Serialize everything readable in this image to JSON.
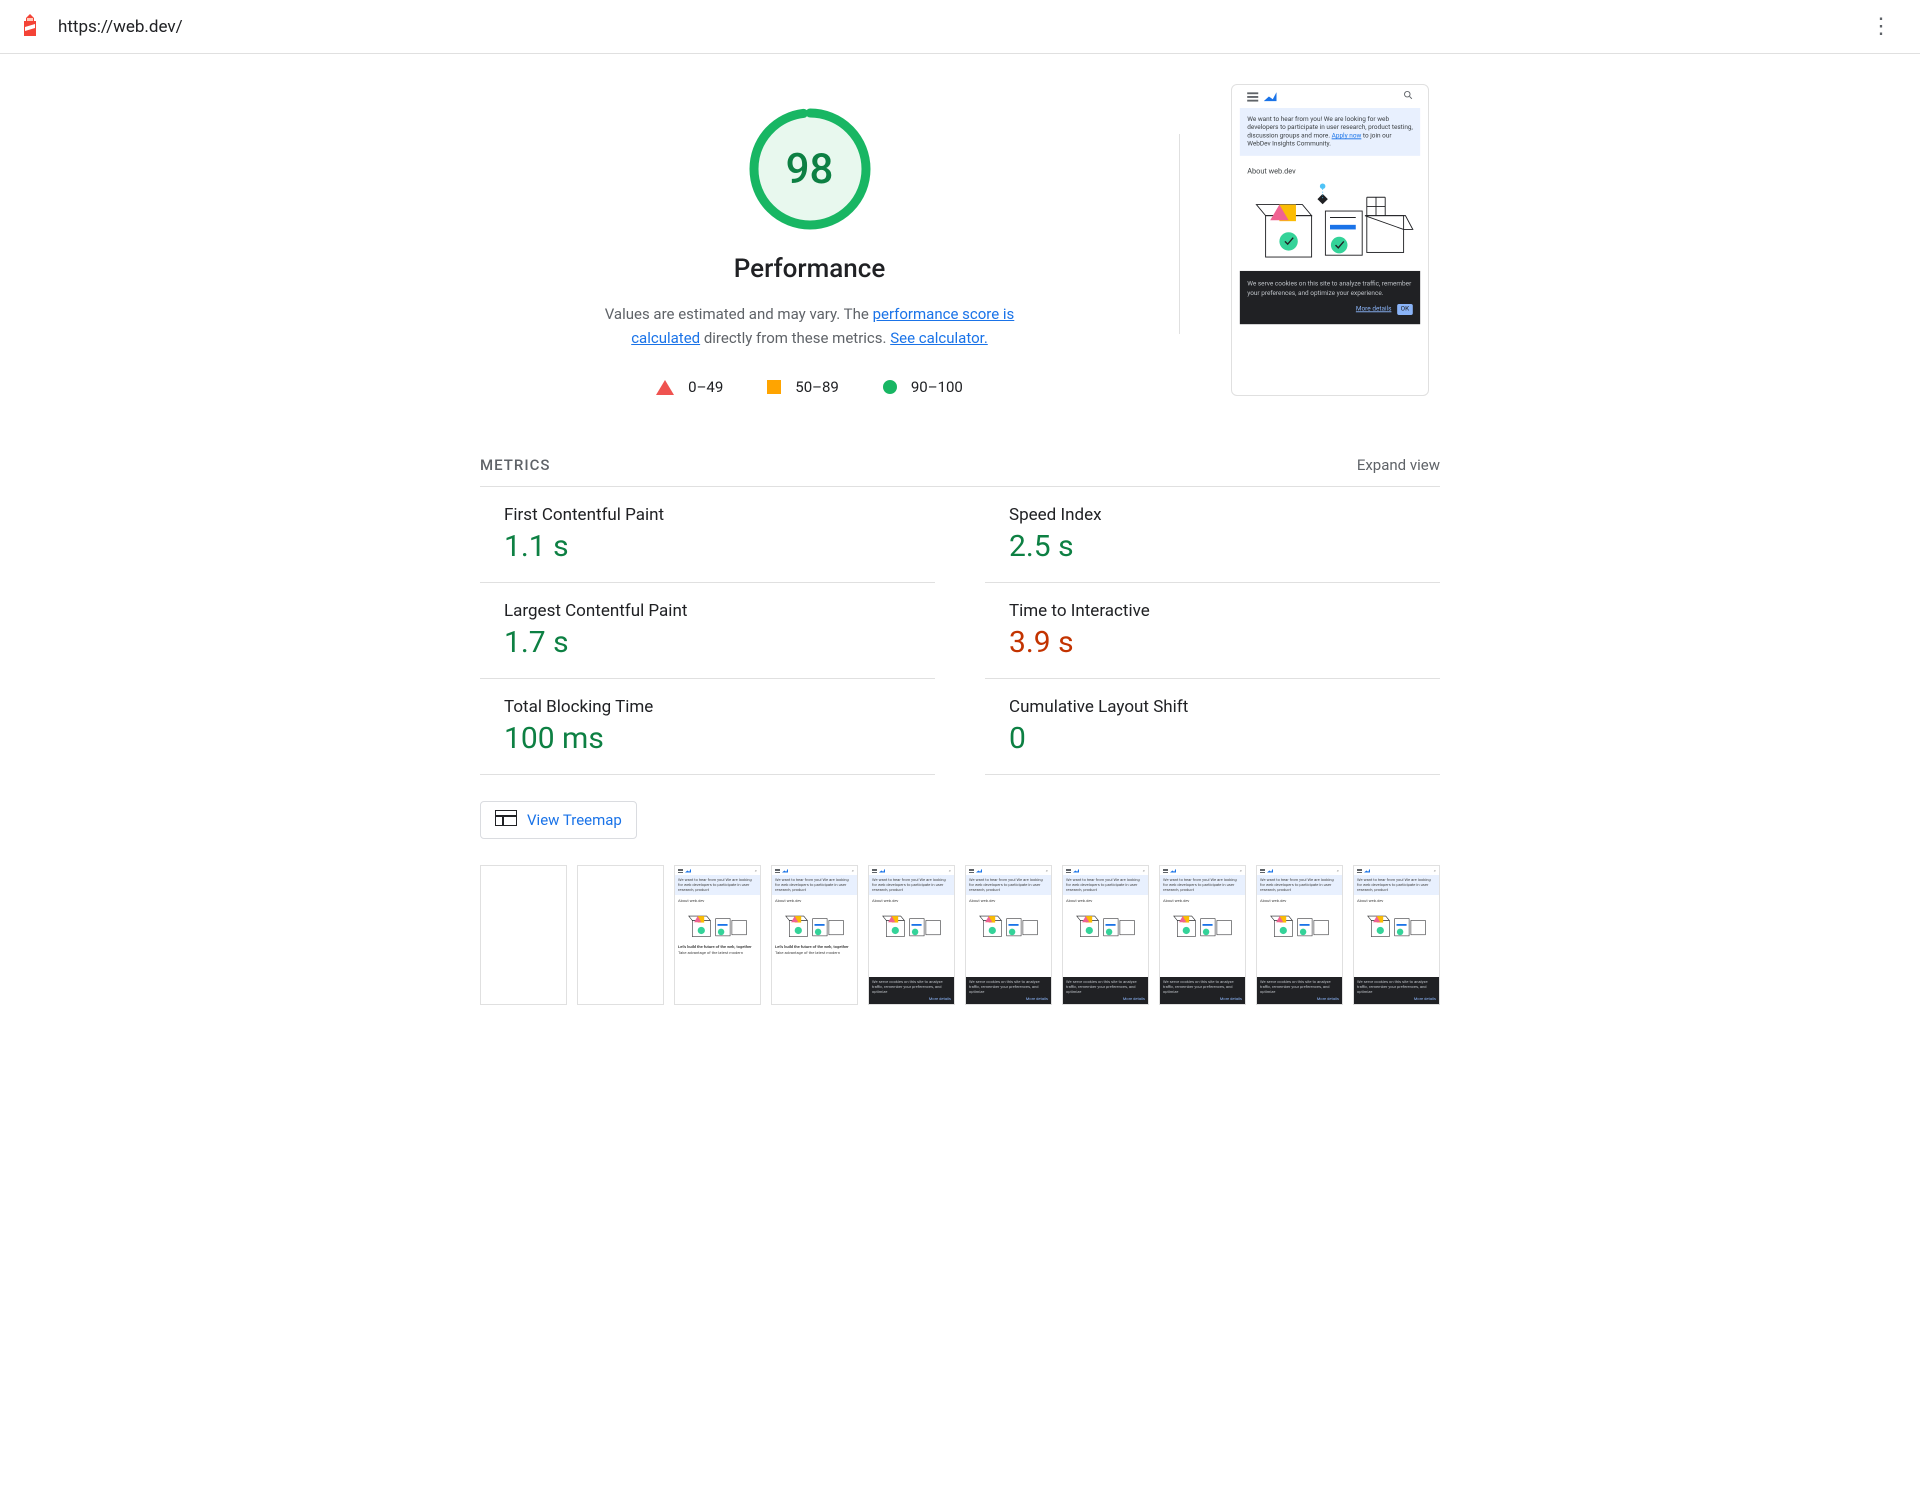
{
  "header": {
    "url": "https://web.dev/"
  },
  "performance": {
    "score": "98",
    "category_label": "Performance",
    "description_pre": "Values are estimated and may vary. The ",
    "description_link1": "performance score is calculated",
    "description_mid": " directly from these metrics. ",
    "description_link2": "See calculator."
  },
  "legend": {
    "fail": "0–49",
    "average": "50–89",
    "pass": "90–100"
  },
  "preview": {
    "banner_text": "We want to hear from you! We are looking for web developers to participate in user research, product testing, discussion groups and more. ",
    "banner_link": "Apply now",
    "banner_tail": " to join our WebDev Insights Community.",
    "about_label": "About web.dev",
    "cookie_text": "We serve cookies on this site to analyze traffic, remember your preferences, and optimize your experience.",
    "more_details": "More details",
    "ok_label": "OK"
  },
  "metrics_section": {
    "title": "Metrics",
    "expand_label": "Expand view"
  },
  "metrics": [
    {
      "name": "First Contentful Paint",
      "value": "1.1 s",
      "status": "pass"
    },
    {
      "name": "Speed Index",
      "value": "2.5 s",
      "status": "pass"
    },
    {
      "name": "Largest Contentful Paint",
      "value": "1.7 s",
      "status": "pass"
    },
    {
      "name": "Time to Interactive",
      "value": "3.9 s",
      "status": "avg"
    },
    {
      "name": "Total Blocking Time",
      "value": "100 ms",
      "status": "pass"
    },
    {
      "name": "Cumulative Layout Shift",
      "value": "0",
      "status": "pass"
    }
  ],
  "treemap": {
    "label": "View Treemap"
  },
  "filmstrip": {
    "frames": [
      {
        "state": "blank"
      },
      {
        "state": "blank"
      },
      {
        "state": "partial_text"
      },
      {
        "state": "partial_text"
      },
      {
        "state": "full"
      },
      {
        "state": "full"
      },
      {
        "state": "full"
      },
      {
        "state": "full"
      },
      {
        "state": "full"
      },
      {
        "state": "full"
      }
    ],
    "build_text_a": "Let's build the future of the web, together",
    "build_text_b": "Take advantage of the latest modern"
  }
}
